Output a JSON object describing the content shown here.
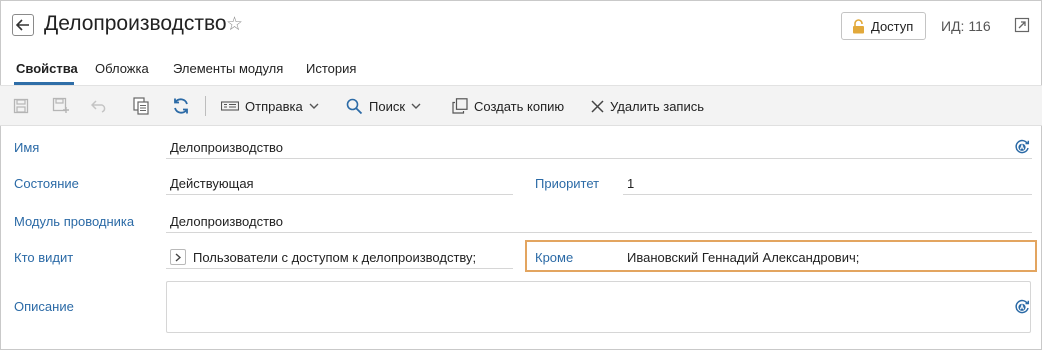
{
  "header": {
    "title": "Делопроизводство",
    "access_label": "Доступ",
    "id_label": "ИД: 116",
    "icons": [
      "back-arrow-icon",
      "star-icon",
      "lock-icon",
      "open-in-new-icon"
    ]
  },
  "tabs": [
    {
      "label": "Свойства",
      "active": true
    },
    {
      "label": "Обложка",
      "active": false
    },
    {
      "label": "Элементы модуля",
      "active": false
    },
    {
      "label": "История",
      "active": false
    }
  ],
  "toolbar": {
    "icons": [
      "save-icon",
      "save-as-icon",
      "undo-icon",
      "copy-icon",
      "refresh-icon"
    ],
    "send_label": "Отправка",
    "search_label": "Поиск",
    "create_copy_label": "Создать копию",
    "delete_label": "Удалить запись"
  },
  "form": {
    "name": {
      "label": "Имя",
      "value": "Делопроизводство"
    },
    "state": {
      "label": "Состояние",
      "value": "Действующая"
    },
    "priority": {
      "label": "Приоритет",
      "value": "1"
    },
    "module": {
      "label": "Модуль проводника",
      "value": "Делопроизводство"
    },
    "who_sees": {
      "label": "Кто видит",
      "value": "Пользователи с доступом к делопроизводству;"
    },
    "except": {
      "label": "Кроме",
      "value": "Ивановский Геннадий Александрович;"
    },
    "description": {
      "label": "Описание",
      "value": ""
    }
  },
  "colors": {
    "label_blue": "#2b6aa6",
    "accent_tab": "#2f6ea8",
    "highlight_orange": "#e3a560",
    "lock_gold": "#e2a93b"
  }
}
